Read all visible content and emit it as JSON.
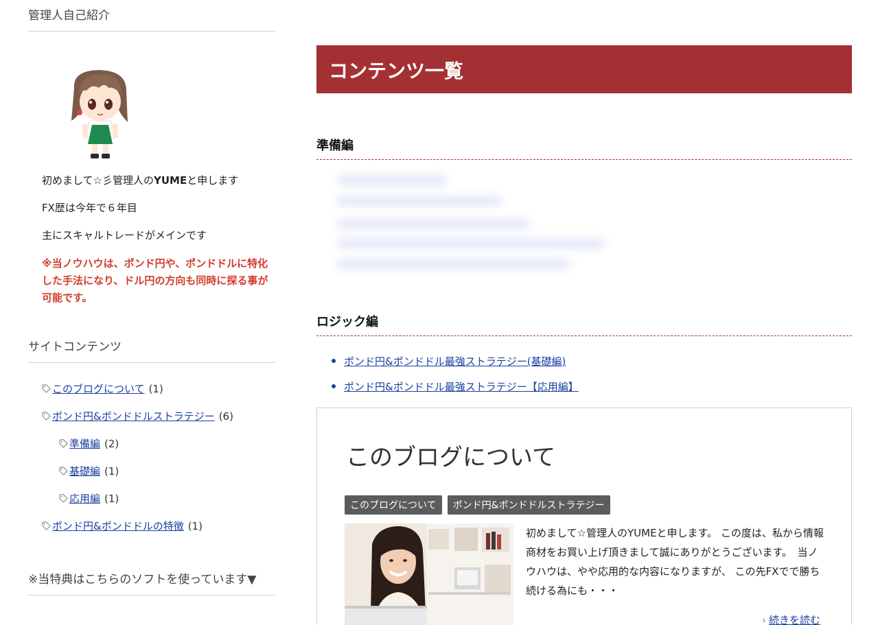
{
  "sidebar": {
    "profile": {
      "title": "管理人自己紹介",
      "intro_line1_pre": "初めまして☆彡管理人の",
      "intro_line1_name": "YUME",
      "intro_line1_post": "と申します",
      "intro_line2": "FX歴は今年で６年目",
      "intro_line3": "主にスキャルトレードがメインです",
      "notice": "※当ノウハウは、ポンド円や、ポンドドルに特化した手法になり、ドル円の方向も同時に探る事が可能です。"
    },
    "contents": {
      "title": "サイトコンテンツ",
      "items": [
        {
          "label": "このブログについて",
          "count": "(1)"
        },
        {
          "label": "ポンド円&ポンドドルストラテジー",
          "count": "(6)"
        },
        {
          "label": "準備編",
          "count": "(2)"
        },
        {
          "label": "基礎編",
          "count": "(1)"
        },
        {
          "label": "応用編",
          "count": "(1)"
        },
        {
          "label": "ポンド円&ポンドドルの特徴",
          "count": "(1)"
        }
      ]
    },
    "software": {
      "title": "※当特典はこちらのソフトを使っています▼"
    }
  },
  "main": {
    "banner": "コンテンツ一覧",
    "section1": {
      "title": "準備編"
    },
    "section2": {
      "title": "ロジック編",
      "links": [
        "ポンド円&ポンドドル最強ストラテジー(基礎編)",
        "ポンド円&ポンドドル最強ストラテジー【応用編】"
      ]
    },
    "card": {
      "title": "このブログについて",
      "tags": [
        "このブログについて",
        "ポンド円&ポンドドルストラテジー"
      ],
      "excerpt": "初めまして☆管理人のYUMEと申します。 この度は、私から情報商材をお買い上げ頂きまして誠にありがとうございます。　当ノウハウは、やや応用的な内容になりますが、 この先FXでで勝ち続ける為にも・・・",
      "more": "続きを読む"
    }
  },
  "colors": {
    "accent": "#a33133",
    "link": "#1a3fa0",
    "notice": "#d33b2c",
    "chip": "#5c5c5c"
  }
}
